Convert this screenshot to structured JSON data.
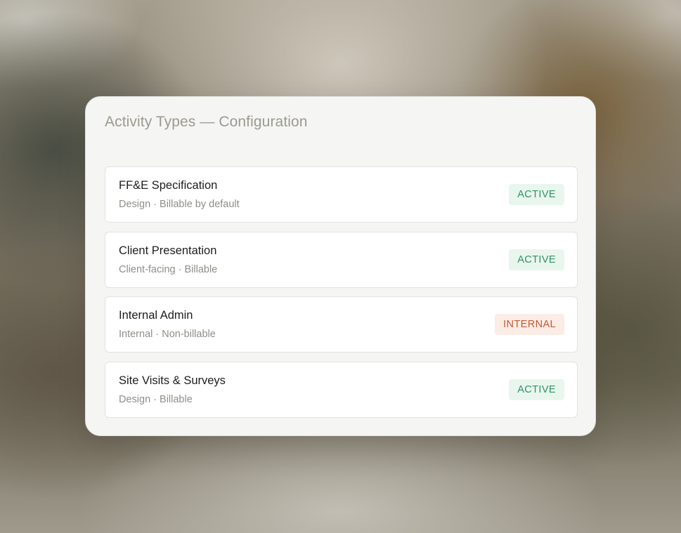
{
  "panel": {
    "title": "Activity Types — Configuration"
  },
  "activities": [
    {
      "name": "FF&E Specification",
      "meta": "Design · Billable by default",
      "status": "ACTIVE",
      "status_kind": "active"
    },
    {
      "name": "Client Presentation",
      "meta": "Client-facing · Billable",
      "status": "ACTIVE",
      "status_kind": "active"
    },
    {
      "name": "Internal Admin",
      "meta": "Internal · Non-billable",
      "status": "INTERNAL",
      "status_kind": "internal"
    },
    {
      "name": "Site Visits & Surveys",
      "meta": "Design · Billable",
      "status": "ACTIVE",
      "status_kind": "active"
    }
  ],
  "colors": {
    "active_text": "#2d9460",
    "active_bg": "#e9f6ee",
    "internal_text": "#c05b31",
    "internal_bg": "#fcece6"
  }
}
